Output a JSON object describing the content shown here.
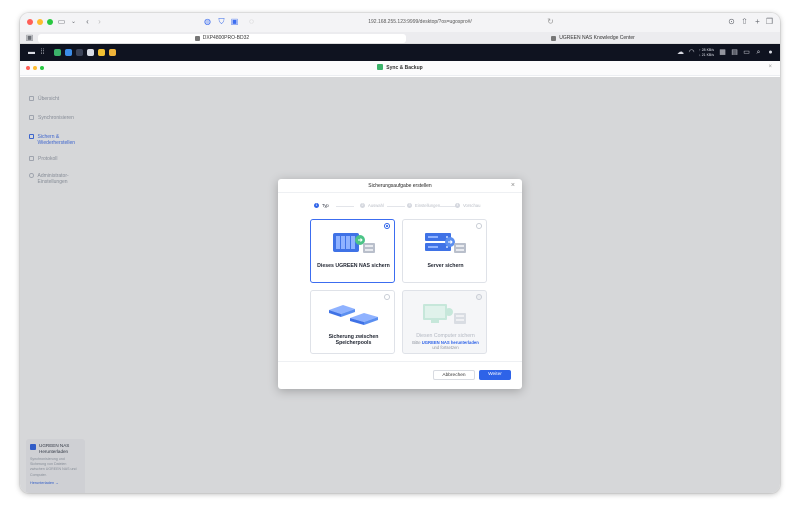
{
  "browser": {
    "url": "192.168.255.123:9999/desktop/?os=ugospro#/",
    "tabs": [
      {
        "label": "DXP4800PRO-BD32"
      },
      {
        "label": "UGREEN NAS Knowledge Center"
      }
    ]
  },
  "nas_bar": {
    "speed_up": "↑ 28 KB/s",
    "speed_down": "↓ 21 KB/s"
  },
  "app": {
    "title": "Sync & Backup",
    "sidebar": {
      "items": [
        {
          "label": "Übersicht"
        },
        {
          "label": "Synchronisieren"
        },
        {
          "label": "Sichern & Wiederherstellen"
        },
        {
          "label": "Protokoll"
        },
        {
          "label": "Administrator-Einstellungen"
        }
      ],
      "promo": {
        "title": "UGREEN NAS Herunterladen",
        "body": "Synchronisierung und Sicherung von Dateien zwischen UGREEN NAS und Computer.",
        "link": "Herunterladen"
      }
    }
  },
  "dialog": {
    "title": "Sicherungsaufgabe erstellen",
    "steps": [
      {
        "num": "1",
        "label": "Typ",
        "active": true
      },
      {
        "num": "2",
        "label": "Auswahl",
        "active": false
      },
      {
        "num": "3",
        "label": "Einstellungen",
        "active": false
      },
      {
        "num": "4",
        "label": "Vorschau",
        "active": false
      }
    ],
    "options": [
      {
        "label": "Dieses UGREEN NAS sichern",
        "selected": true
      },
      {
        "label": "Server sichern",
        "selected": false
      },
      {
        "label": "Sicherung zwischen Speicherpools",
        "selected": false
      },
      {
        "label": "Diesen Computer sichern",
        "selected": false,
        "disabled": true,
        "sub_prefix": "Bitte",
        "sub_link": "UGREEN NAS herunterladen",
        "sub_suffix": "und fortsetzen"
      }
    ],
    "buttons": {
      "cancel": "Abbrechen",
      "next": "Weiter"
    }
  },
  "colors": {
    "accent": "#2e63e8",
    "nav_dark": "#0f1320"
  }
}
